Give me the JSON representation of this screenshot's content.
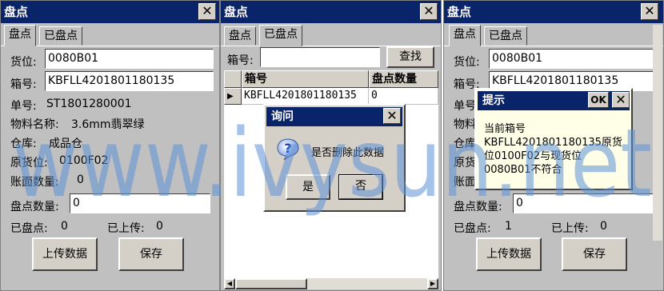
{
  "left": {
    "title": "盘点",
    "close": "✕",
    "tabs": [
      "盘点",
      "已盘点"
    ],
    "location_label": "货位:",
    "location_value": "0080B01",
    "box_label": "箱号:",
    "box_value": "KBFLL4201801180135",
    "order_label": "单号:",
    "order_value": "ST1801280001",
    "material_label": "物料名称:",
    "material_value": "3.6mm翡翠绿",
    "warehouse_label": "仓库:",
    "warehouse_value": "成品仓",
    "orig_loc_label": "原货位:",
    "orig_loc_value": "0100F02",
    "book_qty_label": "账面数量:",
    "book_qty_value": "0",
    "count_qty_label": "盘点数量:",
    "count_qty_value": "0",
    "counted_label": "已盘点:",
    "counted_value": "0",
    "uploaded_label": "已上传:",
    "uploaded_value": "0",
    "upload_button": "上传数据",
    "save_button": "保存"
  },
  "middle": {
    "title": "盘点",
    "close": "✕",
    "tabs": [
      "盘点",
      "已盘点"
    ],
    "box_label": "箱号:",
    "box_value": "",
    "search_button": "查找",
    "columns": [
      "箱号",
      "盘点数量"
    ],
    "rows": [
      [
        "KBFLL4201801180135",
        "0"
      ]
    ],
    "row_indicator": "▶",
    "dialog": {
      "title": "询问",
      "close": "✕",
      "icon": "question-icon",
      "message": "是否删除此数据",
      "yes": "是",
      "no": "否"
    },
    "scroll_left": "◀",
    "scroll_right": "▶"
  },
  "right": {
    "title": "盘点",
    "close": "✕",
    "tabs": [
      "盘点",
      "已盘点"
    ],
    "location_label": "货位:",
    "location_value": "0080B01",
    "box_label": "箱号:",
    "box_value": "KBFLL4201801180135",
    "order_label": "单号",
    "material_label": "物料",
    "warehouse_label": "仓库",
    "orig_loc_label": "原货",
    "book_label": "账面",
    "count_qty_label": "盘点数量:",
    "count_qty_value": "0",
    "counted_label": "已盘点:",
    "counted_value": "1",
    "uploaded_label": "已上传:",
    "uploaded_value": "0",
    "upload_button": "上传数据",
    "save_button": "保存",
    "popup": {
      "title": "提示",
      "ok": "OK",
      "close": "✕",
      "line1": "当前箱号",
      "line2": "KBFLL4201801180135原货",
      "line3": "位0100F02与现货位",
      "line4": "0080B01不符合"
    }
  },
  "watermark": "www.ivysun.net",
  "colors": {
    "titlebar": "#0a246a",
    "window": "#c0c0c0",
    "watermark": "#5b8fd6"
  }
}
